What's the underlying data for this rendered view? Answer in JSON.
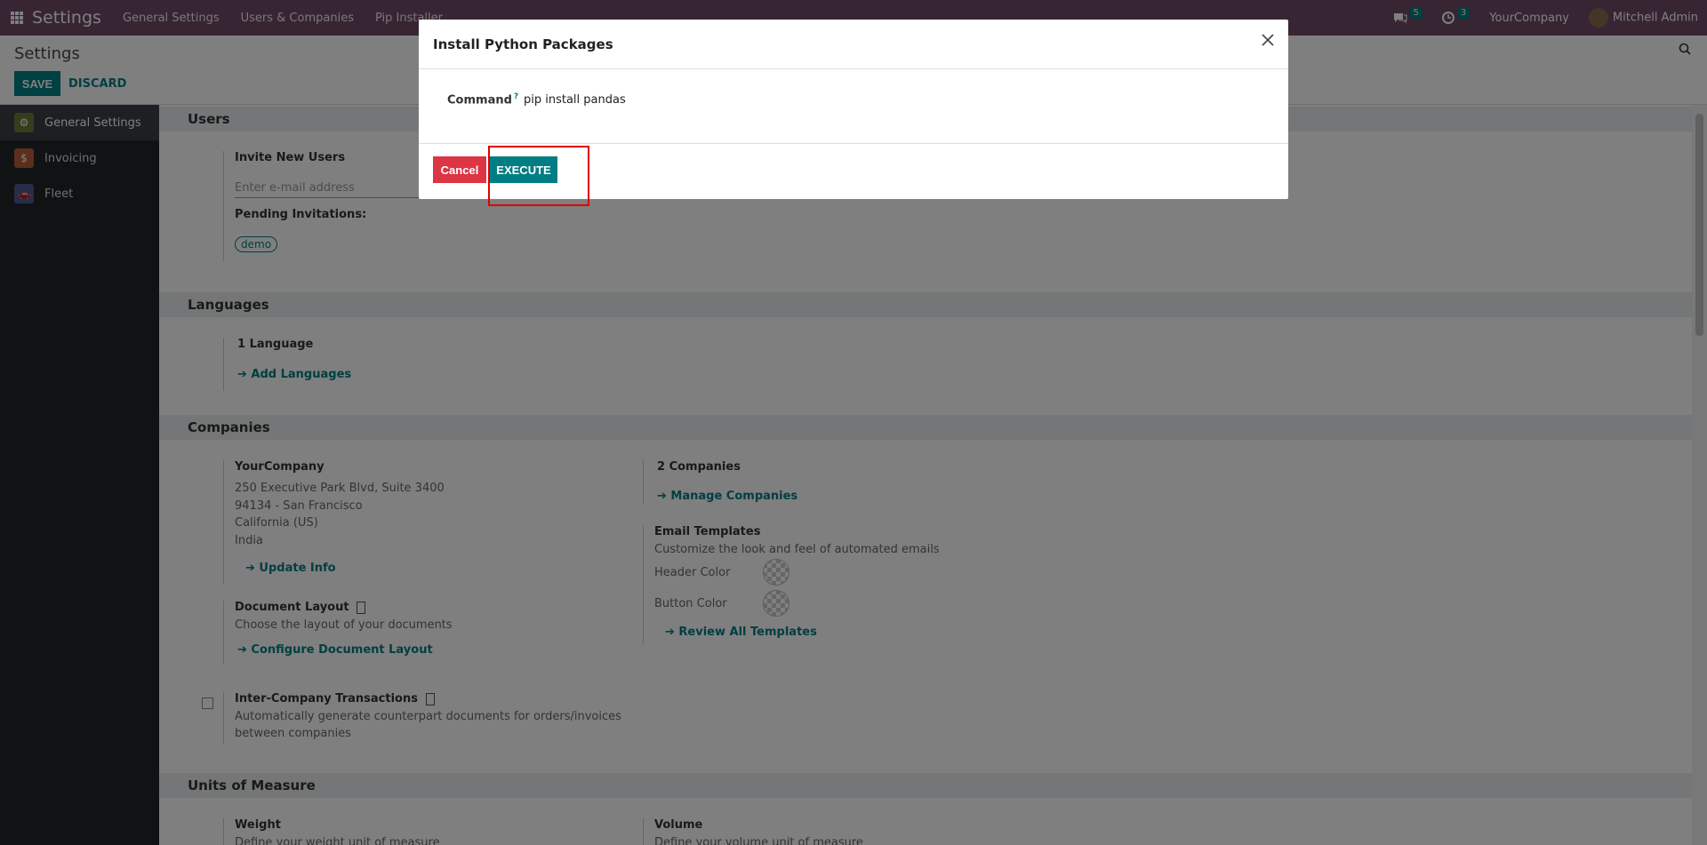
{
  "navbar": {
    "app_title": "Settings",
    "menus": [
      "General Settings",
      "Users & Companies",
      "Pip Installer"
    ],
    "messages_count": "5",
    "activities_count": "3",
    "company": "YourCompany",
    "user": "Mitchell Admin"
  },
  "control_panel": {
    "title": "Settings",
    "save_label": "SAVE",
    "discard_label": "DISCARD"
  },
  "sidebar": {
    "items": [
      {
        "label": "General Settings",
        "icon": "gear-icon",
        "color": "#6b7a3a"
      },
      {
        "label": "Invoicing",
        "icon": "invoice-icon",
        "color": "#b85c3a"
      },
      {
        "label": "Fleet",
        "icon": "car-icon",
        "color": "#4f5b93"
      }
    ]
  },
  "content": {
    "users": {
      "header": "Users",
      "invite_title": "Invite New Users",
      "email_placeholder": "Enter e-mail address",
      "pending_title": "Pending Invitations:",
      "pending_tag": "demo"
    },
    "languages": {
      "header": "Languages",
      "count": "1 Language",
      "add_link": "Add Languages"
    },
    "companies": {
      "header": "Companies",
      "company_name": "YourCompany",
      "address_lines": [
        "250 Executive Park Blvd, Suite 3400",
        "94134 - San Francisco",
        "California (US)",
        "India"
      ],
      "update_link": "Update Info",
      "count": "2 Companies",
      "manage_link": "Manage Companies",
      "email_templates_title": "Email Templates",
      "email_templates_desc": "Customize the look and feel of automated emails",
      "header_color_label": "Header Color",
      "button_color_label": "Button Color",
      "review_link": "Review All Templates",
      "doc_layout_title": "Document Layout",
      "doc_layout_desc": "Choose the layout of your documents",
      "doc_layout_link": "Configure Document Layout",
      "intercompany_title": "Inter-Company Transactions",
      "intercompany_desc_1": "Automatically generate counterpart documents for orders/invoices",
      "intercompany_desc_2": "between companies"
    },
    "uom": {
      "header": "Units of Measure",
      "weight_title": "Weight",
      "weight_desc": "Define your weight unit of measure",
      "volume_title": "Volume",
      "volume_desc": "Define your volume unit of measure"
    }
  },
  "modal": {
    "title": "Install Python Packages",
    "command_label": "Command",
    "command_help": "?",
    "command_value": "pip install pandas",
    "cancel_label": "Cancel",
    "execute_label": "EXECUTE"
  }
}
